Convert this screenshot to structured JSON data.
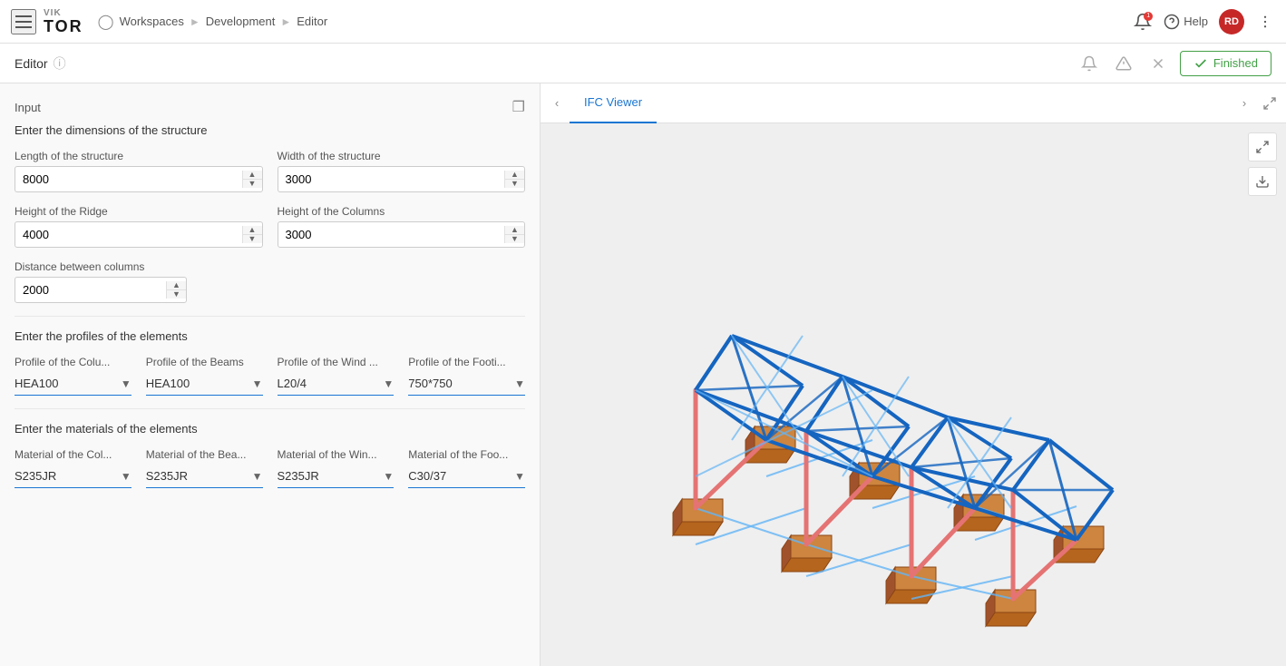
{
  "app": {
    "logo_top": "VIK",
    "logo_bottom": "TOR"
  },
  "nav": {
    "workspaces_label": "Workspaces",
    "development_label": "Development",
    "editor_label": "Editor",
    "help_label": "Help",
    "avatar_initials": "RD",
    "notification_count": "1"
  },
  "sub_header": {
    "title": "Editor",
    "finished_label": "Finished"
  },
  "left_panel": {
    "title": "Input",
    "section1_title": "Enter the dimensions of the structure",
    "length_label": "Length of the structure",
    "length_value": "8000",
    "width_label": "Width of the structure",
    "width_value": "3000",
    "ridge_label": "Height of the Ridge",
    "ridge_value": "4000",
    "columns_height_label": "Height of the Columns",
    "columns_height_value": "3000",
    "distance_label": "Distance between columns",
    "distance_value": "2000",
    "section2_title": "Enter the profiles of the elements",
    "profile_columns_label": "Profile of the Colu...",
    "profile_columns_value": "HEA100",
    "profile_beams_label": "Profile of the Beams",
    "profile_beams_value": "HEA100",
    "profile_wind_label": "Profile of the Wind ...",
    "profile_wind_value": "L20/4",
    "profile_footing_label": "Profile of the Footi...",
    "profile_footing_value": "750*750",
    "section3_title": "Enter the materials of the elements",
    "material_columns_label": "Material of the Col...",
    "material_columns_value": "S235JR",
    "material_beams_label": "Material of the Bea...",
    "material_beams_value": "S235JR",
    "material_wind_label": "Material of the Win...",
    "material_wind_value": "S235JR",
    "material_footing_label": "Material of the Foo...",
    "material_footing_value": "C30/37"
  },
  "tabs": [
    {
      "id": "ifc-viewer",
      "label": "IFC Viewer",
      "active": true
    }
  ],
  "colors": {
    "accent": "#1976d2",
    "finished_green": "#43a047",
    "structure_blue": "#1565c0",
    "structure_red": "#e53935",
    "footing_brown": "#c67c2a",
    "bracing_light_blue": "#42a5f5"
  }
}
